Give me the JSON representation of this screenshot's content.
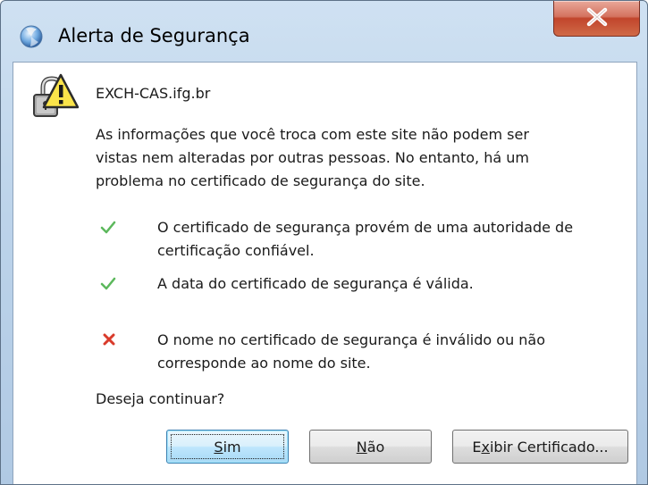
{
  "window": {
    "title": "Alerta de Segurança",
    "close_label": "X"
  },
  "content": {
    "site": "EXCH-CAS.ifg.br",
    "intro_lines": [
      "As informações que você troca com este site não podem ser",
      "vistas nem alteradas por outras pessoas. No entanto, há um",
      "problema no certificado de segurança do site."
    ],
    "checks": [
      {
        "status": "ok",
        "icon": "green-check-icon",
        "lines": [
          "O certificado de segurança provém de uma autoridade de",
          "certificação confiável."
        ]
      },
      {
        "status": "ok",
        "icon": "green-check-icon",
        "lines": [
          "A data do certificado de segurança é válida."
        ]
      },
      {
        "status": "error",
        "icon": "red-x-icon",
        "lines": [
          "O nome no certificado de segurança é inválido ou não",
          "corresponde ao nome do site."
        ]
      }
    ],
    "question": "Deseja continuar?"
  },
  "buttons": {
    "yes": {
      "label": "Sim",
      "mnemonic": "S",
      "rest": "im"
    },
    "no": {
      "label": "Não",
      "mnemonic": "N",
      "rest": "ão"
    },
    "view_cert": {
      "label": "Exibir Certificado...",
      "pre": "E",
      "mnemonic": "x",
      "rest": "ibir Certificado..."
    }
  },
  "colors": {
    "check": "#5cb85c",
    "error": "#d93b2b",
    "close_button": "#c9503a"
  }
}
